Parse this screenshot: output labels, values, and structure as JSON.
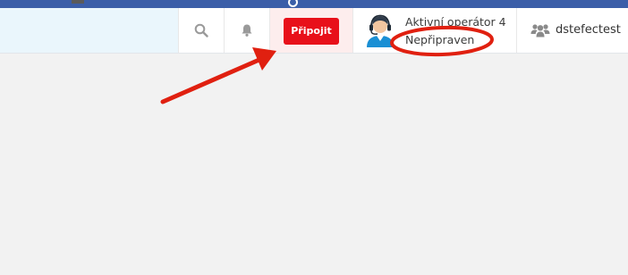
{
  "header": {
    "connect_label": "Připojit",
    "operator_name": "Aktivní operátor 4",
    "operator_status": "Nepřipraven",
    "user_name": "dstefectest"
  },
  "icons": {
    "search": "search-icon",
    "bell": "bell-icon",
    "operator_avatar": "operator-headset-avatar",
    "users": "users-icon"
  },
  "annotations": {
    "arrow": "arrow-to-connect-button",
    "highlight": "ellipse-around-status"
  },
  "colors": {
    "connect_button": "#e8101a",
    "annotation_red": "#e02010",
    "header_left_bg": "#eaf6fc",
    "page_bg": "#f2f2f2",
    "browser_bar": "#3b5ea8"
  }
}
